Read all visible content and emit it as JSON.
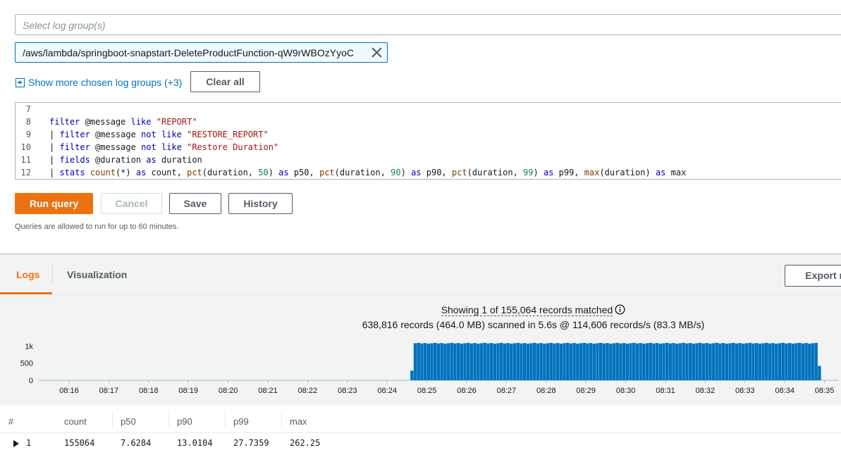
{
  "log_groups": {
    "placeholder": "Select log group(s)",
    "selected_token": "/aws/lambda/springboot-snapstart-DeleteProductFunction-qW9rWBOzYyoC",
    "show_more_label": "Show more chosen log groups (+3)",
    "clear_all_label": "Clear all"
  },
  "editor": {
    "lines": [
      {
        "number": "7",
        "tokens": []
      },
      {
        "number": "8",
        "tokens": [
          {
            "t": "filter",
            "c": "kw"
          },
          {
            "t": " @message ",
            "c": ""
          },
          {
            "t": "like",
            "c": "kw"
          },
          {
            "t": " ",
            "c": ""
          },
          {
            "t": "\"REPORT\"",
            "c": "str"
          }
        ]
      },
      {
        "number": "9",
        "tokens": [
          {
            "t": "| ",
            "c": "pipe"
          },
          {
            "t": "filter",
            "c": "kw"
          },
          {
            "t": " @message ",
            "c": ""
          },
          {
            "t": "not like",
            "c": "kw"
          },
          {
            "t": " ",
            "c": ""
          },
          {
            "t": "\"RESTORE_REPORT\"",
            "c": "str"
          }
        ]
      },
      {
        "number": "10",
        "tokens": [
          {
            "t": "| ",
            "c": "pipe"
          },
          {
            "t": "filter",
            "c": "kw"
          },
          {
            "t": " @message ",
            "c": ""
          },
          {
            "t": "not like",
            "c": "kw"
          },
          {
            "t": " ",
            "c": ""
          },
          {
            "t": "\"Restore Duration\"",
            "c": "str"
          }
        ]
      },
      {
        "number": "11",
        "tokens": [
          {
            "t": "| ",
            "c": "pipe"
          },
          {
            "t": "fields",
            "c": "kw"
          },
          {
            "t": " @duration ",
            "c": ""
          },
          {
            "t": "as",
            "c": "kw"
          },
          {
            "t": " duration",
            "c": ""
          }
        ]
      },
      {
        "number": "12",
        "tokens": [
          {
            "t": "| ",
            "c": "pipe"
          },
          {
            "t": "stats",
            "c": "kw"
          },
          {
            "t": " ",
            "c": ""
          },
          {
            "t": "count",
            "c": "fn"
          },
          {
            "t": "(*) ",
            "c": ""
          },
          {
            "t": "as",
            "c": "kw"
          },
          {
            "t": " count, ",
            "c": ""
          },
          {
            "t": "pct",
            "c": "fn"
          },
          {
            "t": "(duration, ",
            "c": ""
          },
          {
            "t": "50",
            "c": "num"
          },
          {
            "t": ") ",
            "c": ""
          },
          {
            "t": "as",
            "c": "kw"
          },
          {
            "t": " p50, ",
            "c": ""
          },
          {
            "t": "pct",
            "c": "fn"
          },
          {
            "t": "(duration, ",
            "c": ""
          },
          {
            "t": "90",
            "c": "num"
          },
          {
            "t": ") ",
            "c": ""
          },
          {
            "t": "as",
            "c": "kw"
          },
          {
            "t": " p90, ",
            "c": ""
          },
          {
            "t": "pct",
            "c": "fn"
          },
          {
            "t": "(duration, ",
            "c": ""
          },
          {
            "t": "99",
            "c": "num"
          },
          {
            "t": ") ",
            "c": ""
          },
          {
            "t": "as",
            "c": "kw"
          },
          {
            "t": " p99, ",
            "c": ""
          },
          {
            "t": "max",
            "c": "fn"
          },
          {
            "t": "(duration) ",
            "c": ""
          },
          {
            "t": "as",
            "c": "kw"
          },
          {
            "t": " max",
            "c": ""
          }
        ]
      }
    ]
  },
  "actions": {
    "run_query": "Run query",
    "cancel": "Cancel",
    "save": "Save",
    "history": "History",
    "note": "Queries are allowed to run for up to 60 minutes."
  },
  "results": {
    "tabs": [
      "Logs",
      "Visualization"
    ],
    "active_tab": "Logs",
    "export_label": "Export re",
    "showing_text": "Showing 1 of 155,064 records matched",
    "scanned_text": "638,816 records (464.0 MB) scanned in 5.6s @ 114,606 records/s (83.3 MB/s)"
  },
  "chart_data": {
    "type": "bar",
    "color": "#0073bb",
    "ytick_labels": [
      "1k",
      "500",
      "0"
    ],
    "ylim": [
      0,
      1150
    ],
    "xtick_labels": [
      "08:16",
      "08:17",
      "08:18",
      "08:19",
      "08:20",
      "08:21",
      "08:22",
      "08:23",
      "08:24",
      "08:25",
      "08:26",
      "08:27",
      "08:28",
      "08:29",
      "08:30",
      "08:31",
      "08:32",
      "08:33",
      "08:34",
      "08:35"
    ],
    "x_start_minute": "08:16",
    "bars_start": "08:24:35",
    "bars_end": "08:34:55",
    "typical_value": 1080,
    "first_bar_value": 280,
    "last_bar_value": 420
  },
  "table": {
    "columns": [
      "#",
      "count",
      "p50",
      "p90",
      "p99",
      "max"
    ],
    "rows": [
      [
        "1",
        "155064",
        "7.6284",
        "13.0104",
        "27.7359",
        "262.25"
      ]
    ]
  }
}
